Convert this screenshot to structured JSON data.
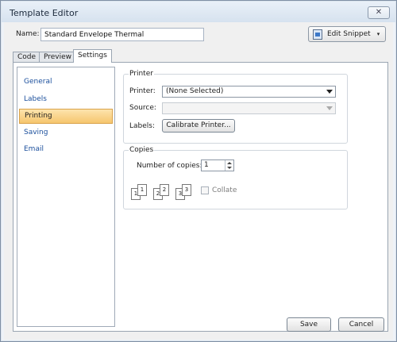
{
  "window": {
    "title": "Template Editor",
    "close_glyph": "✕"
  },
  "header": {
    "name_label": "Name:",
    "name_value": "Standard Envelope Thermal",
    "snippet_button": {
      "label": "Edit Snippet",
      "icon": "snippet-icon",
      "arrow": "▾"
    }
  },
  "tabs": [
    {
      "label": "Code"
    },
    {
      "label": "Preview"
    },
    {
      "label": "Settings",
      "active": true
    }
  ],
  "sidebar": {
    "items": [
      {
        "label": "General"
      },
      {
        "label": "Labels"
      },
      {
        "label": "Printing",
        "selected": true
      },
      {
        "label": "Saving"
      },
      {
        "label": "Email"
      }
    ]
  },
  "printer_group": {
    "title": "Printer",
    "printer_label": "Printer:",
    "printer_value": "(None Selected)",
    "source_label": "Source:",
    "source_value": "",
    "labels_label": "Labels:",
    "calibrate_button": "Calibrate Printer..."
  },
  "copies_group": {
    "title": "Copies",
    "copies_label": "Number of copies:",
    "copies_value": "1",
    "pages": [
      "1",
      "1",
      "2",
      "2",
      "3",
      "3"
    ],
    "collate_label": "Collate",
    "collate_checked": false
  },
  "footer": {
    "save_label": "Save",
    "cancel_label": "Cancel"
  },
  "colors": {
    "accent_selection": "#f6c66e",
    "link_text": "#1b4f9c"
  }
}
